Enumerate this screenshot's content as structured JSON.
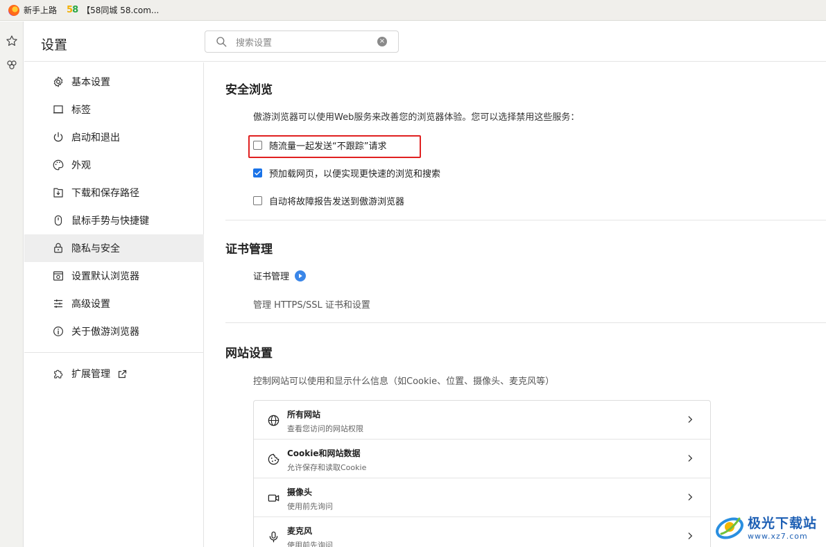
{
  "bookmarks": [
    {
      "label": "新手上路",
      "icon": "firefox-icon"
    },
    {
      "label": "【58同城 58.com...",
      "icon": "58-logo-icon"
    }
  ],
  "rail": {
    "icons": [
      "star-icon",
      "extension-clover-icon"
    ]
  },
  "header": {
    "title": "设置",
    "search_placeholder": "搜索设置"
  },
  "sidebar": {
    "items": [
      {
        "label": "基本设置",
        "icon": "gear-icon",
        "active": false
      },
      {
        "label": "标签",
        "icon": "tab-icon",
        "active": false
      },
      {
        "label": "启动和退出",
        "icon": "power-icon",
        "active": false
      },
      {
        "label": "外观",
        "icon": "palette-icon",
        "active": false
      },
      {
        "label": "下载和保存路径",
        "icon": "download-icon",
        "active": false
      },
      {
        "label": "鼠标手势与快捷键",
        "icon": "mouse-icon",
        "active": false
      },
      {
        "label": "隐私与安全",
        "icon": "lock-icon",
        "active": true
      },
      {
        "label": "设置默认浏览器",
        "icon": "browser-icon",
        "active": false
      },
      {
        "label": "高级设置",
        "icon": "sliders-icon",
        "active": false
      },
      {
        "label": "关于傲游浏览器",
        "icon": "info-icon",
        "active": false
      }
    ],
    "extensions": {
      "label": "扩展管理",
      "icon": "puzzle-icon"
    }
  },
  "safe_browsing": {
    "title": "安全浏览",
    "description": "傲游浏览器可以使用Web服务来改善您的浏览器体验。您可以选择禁用这些服务：",
    "options": [
      {
        "label": "随流量一起发送“不跟踪”请求",
        "checked": false
      },
      {
        "label": "预加载网页，以便实现更快速的浏览和搜索",
        "checked": true
      },
      {
        "label": "自动将故障报告发送到傲游浏览器",
        "checked": false
      }
    ]
  },
  "certificates": {
    "title": "证书管理",
    "link_label": "证书管理",
    "description": "管理 HTTPS/SSL 证书和设置"
  },
  "site_settings": {
    "title": "网站设置",
    "description": "控制网站可以使用和显示什么信息（如Cookie、位置、摄像头、麦克风等）",
    "rows": [
      {
        "title": "所有网站",
        "subtitle": "查看您访问的网站权限",
        "icon": "globe-icon"
      },
      {
        "title": "Cookie和网站数据",
        "subtitle": "允许保存和读取Cookie",
        "icon": "cookie-icon"
      },
      {
        "title": "摄像头",
        "subtitle": "使用前先询问",
        "icon": "camera-icon"
      },
      {
        "title": "麦克风",
        "subtitle": "使用前先询问",
        "icon": "microphone-icon"
      }
    ]
  },
  "watermark": {
    "line1": "极光下载站",
    "line2": "www.xz7.com"
  },
  "colors": {
    "accent": "#1a73e8",
    "highlight_box": "#e02020",
    "active_nav": "#eeeeee"
  }
}
